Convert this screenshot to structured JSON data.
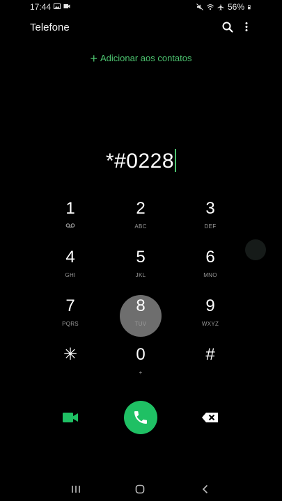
{
  "status_bar": {
    "time": "17:44",
    "battery": "56%",
    "icons": [
      "image-icon",
      "screen-record-icon",
      "mute-icon",
      "wifi-icon",
      "airplane-icon",
      "battery-icon"
    ]
  },
  "header": {
    "title": "Telefone",
    "icons": [
      "search-icon",
      "more-vertical-icon"
    ]
  },
  "add_contacts": {
    "plus": "+",
    "label": "Adicionar aos contatos"
  },
  "dialer": {
    "number": "*#0228"
  },
  "keypad": {
    "k1": {
      "digit": "1",
      "sub_icon": "voicemail-icon"
    },
    "k2": {
      "digit": "2",
      "letters": "ABC"
    },
    "k3": {
      "digit": "3",
      "letters": "DEF"
    },
    "k4": {
      "digit": "4",
      "letters": "GHI"
    },
    "k5": {
      "digit": "5",
      "letters": "JKL"
    },
    "k6": {
      "digit": "6",
      "letters": "MNO"
    },
    "k7": {
      "digit": "7",
      "letters": "PQRS"
    },
    "k8": {
      "digit": "8",
      "letters": "TUV"
    },
    "k9": {
      "digit": "9",
      "letters": "WXYZ"
    },
    "kstar": {
      "digit": "✳"
    },
    "k0": {
      "digit": "0",
      "letters": "+"
    },
    "khash": {
      "digit": "#"
    }
  },
  "actions": {
    "video": "video-call-icon",
    "call": "phone-icon",
    "backspace": "backspace-icon"
  },
  "colors": {
    "accent_green": "#4cc36f",
    "call_green": "#1fc064",
    "background": "#000000"
  },
  "nav": [
    "recent-apps-icon",
    "home-icon",
    "back-icon"
  ]
}
